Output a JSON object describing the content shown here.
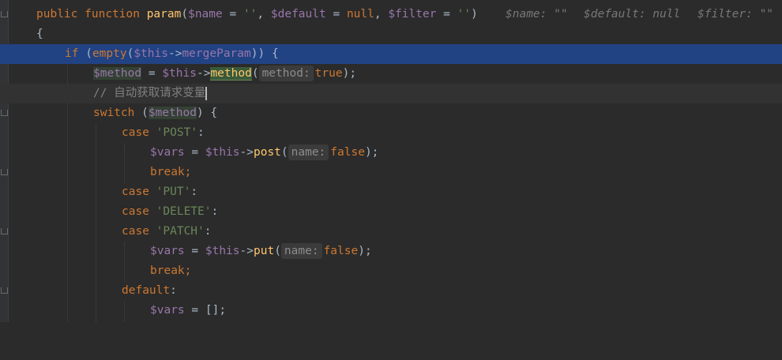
{
  "code": {
    "l1": {
      "public": "public",
      "function": "function",
      "name": "param",
      "paren_open": "(",
      "p1": "$name",
      "eq1": " = ",
      "v1": "''",
      "comma1": ", ",
      "p2": "$default",
      "eq2": " = ",
      "v2": "null",
      "comma2": ", ",
      "p3": "$filter",
      "eq3": " = ",
      "v3": "''",
      "paren_close": ")",
      "hint1": "$name: \"\"",
      "hint2": "$default: null",
      "hint3": "$filter: \"\""
    },
    "l2": {
      "brace": "{"
    },
    "l3": {
      "if": "if",
      "open": " (",
      "empty": "empty",
      "open2": "(",
      "this": "$this",
      "arrow": "->",
      "prop": "mergeParam",
      "close": ")) {"
    },
    "l4": {
      "var": "$method",
      "eq": " = ",
      "this": "$this",
      "arrow": "->",
      "call": "method",
      "open": "(",
      "hint": "method:",
      "arg": "true",
      "close": ");"
    },
    "l5": {
      "comment": "// 自动获取请求变量"
    },
    "l6": {
      "switch": "switch",
      "open": " (",
      "var": "$method",
      "close": ") {"
    },
    "l7": {
      "case": "case",
      "value": "'POST'",
      "colon": ":"
    },
    "l8": {
      "var": "$vars",
      "eq": " = ",
      "this": "$this",
      "arrow": "->",
      "call": "post",
      "open": "(",
      "hint": "name:",
      "arg": "false",
      "close": ");"
    },
    "l9": {
      "break": "break",
      "semi": ";"
    },
    "l10": {
      "case": "case",
      "value": "'PUT'",
      "colon": ":"
    },
    "l11": {
      "case": "case",
      "value": "'DELETE'",
      "colon": ":"
    },
    "l12": {
      "case": "case",
      "value": "'PATCH'",
      "colon": ":"
    },
    "l13": {
      "var": "$vars",
      "eq": " = ",
      "this": "$this",
      "arrow": "->",
      "call": "put",
      "open": "(",
      "hint": "name:",
      "arg": "false",
      "close": ");"
    },
    "l14": {
      "break": "break",
      "semi": ";"
    },
    "l15": {
      "default": "default",
      "colon": ":"
    },
    "l16": {
      "var": "$vars",
      "eq": " = ",
      "value": "[];"
    }
  },
  "colors": {
    "background": "#2b2b2b",
    "keyword": "#cc7832",
    "function": "#ffc66d",
    "variable": "#9876aa",
    "string": "#6a8759",
    "comment": "#808080",
    "selection": "#214283"
  }
}
